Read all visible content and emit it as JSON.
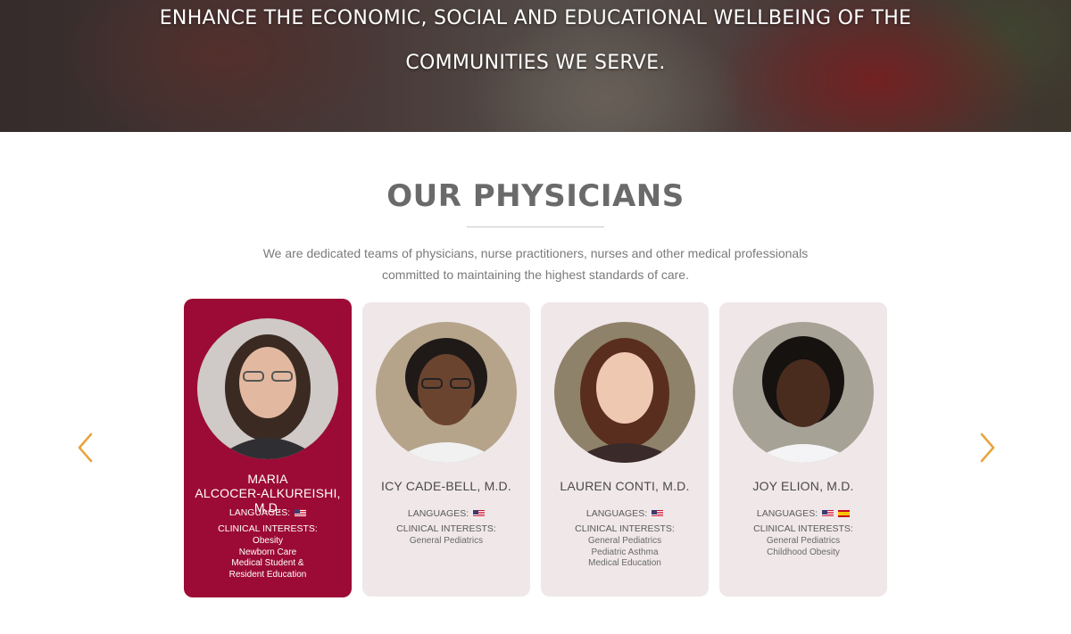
{
  "hero": {
    "line1": "ENHANCE THE ECONOMIC, SOCIAL AND EDUCATIONAL WELLBEING OF THE",
    "line2": "COMMUNITIES WE SERVE."
  },
  "physicians_section": {
    "title": "OUR PHYSICIANS",
    "intro_line1": "We are dedicated teams of physicians, nurse practitioners, nurses and other medical professionals",
    "intro_line2": "committed to maintaining the highest standards of care.",
    "languages_label": "LANGUAGES:",
    "clinical_label": "CLINICAL INTERESTS:",
    "physicians": [
      {
        "name_line1": "MARIA",
        "name_line2": "ALCOCER-ALKUREISHI, M.D.",
        "languages": [
          "us-flag-icon"
        ],
        "interests": [
          "Obesity",
          "Newborn Care",
          "Medical Student &",
          "Resident Education"
        ],
        "active": true
      },
      {
        "name_line1": "ICY CADE-BELL, M.D.",
        "name_line2": "",
        "languages": [
          "us-flag-icon"
        ],
        "interests": [
          "General Pediatrics"
        ],
        "active": false
      },
      {
        "name_line1": "LAUREN CONTI, M.D.",
        "name_line2": "",
        "languages": [
          "us-flag-icon"
        ],
        "interests": [
          "General Pediatrics",
          "Pediatric Asthma",
          "Medical Education"
        ],
        "active": false
      },
      {
        "name_line1": "JOY ELION, M.D.",
        "name_line2": "",
        "languages": [
          "us-flag-icon",
          "spain-flag-icon"
        ],
        "interests": [
          "General Pediatrics",
          "Childhood Obesity"
        ],
        "active": false
      }
    ]
  },
  "colors": {
    "active_card": "#9c0b35",
    "card": "#efe7e8",
    "arrow": "#e8a33c"
  },
  "icons": {
    "prev": "chevron-left-icon",
    "next": "chevron-right-icon"
  }
}
